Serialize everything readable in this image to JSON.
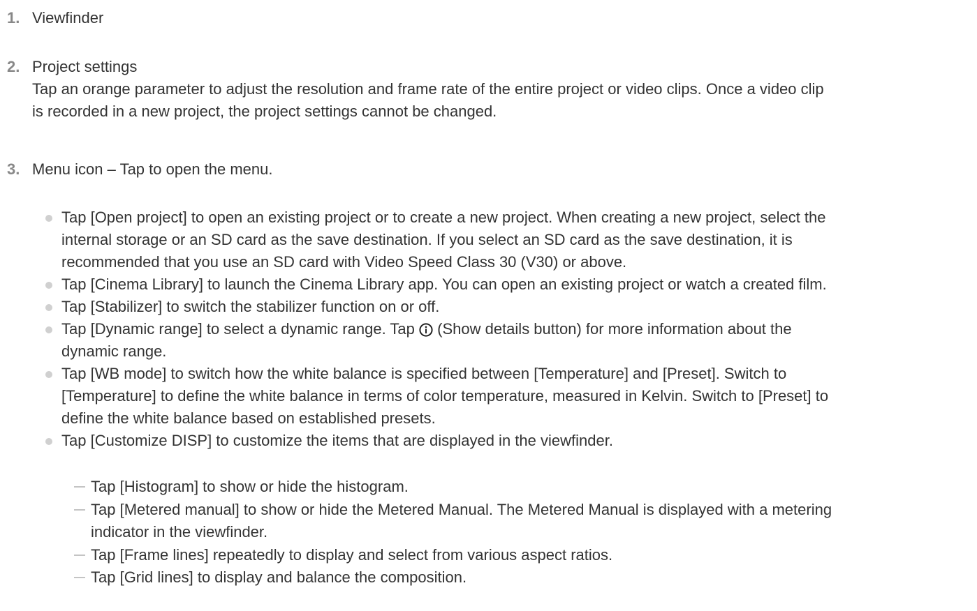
{
  "items": [
    {
      "number": "1.",
      "title": "Viewfinder"
    },
    {
      "number": "2.",
      "title": "Project settings",
      "desc_line1": "Tap an orange parameter to adjust the resolution and frame rate of the entire project or video clips. Once a video clip",
      "desc_line2": "is recorded in a new project, the project settings cannot be changed."
    },
    {
      "number": "3.",
      "title": "Menu icon – Tap to open the menu."
    }
  ],
  "bullets": [
    {
      "lines": [
        "Tap [Open project] to open an existing project or to create a new project. When creating a new project, select the",
        "internal storage or an SD card as the save destination. If you select an SD card as the save destination, it is",
        "recommended that you use an SD card with Video Speed Class 30 (V30) or above."
      ]
    },
    {
      "lines": [
        "Tap [Cinema Library] to launch the Cinema Library app. You can open an existing project or watch a created film."
      ]
    },
    {
      "lines": [
        "Tap [Stabilizer] to switch the stabilizer function on or off."
      ]
    },
    {
      "line1_before_icon": "Tap [Dynamic range] to select a dynamic range. Tap",
      "line1_after_icon": "(Show details button) for more information about the",
      "line2": "dynamic range.",
      "icon": "info-icon"
    },
    {
      "lines": [
        "Tap [WB mode] to switch how the white balance is specified between [Temperature] and [Preset]. Switch to",
        "[Temperature] to define the white balance in terms of color temperature, measured in Kelvin. Switch to [Preset] to",
        "define the white balance based on established presets."
      ]
    },
    {
      "lines": [
        "Tap [Customize DISP] to customize the items that are displayed in the viewfinder."
      ]
    }
  ],
  "sub_items": [
    {
      "lines": [
        "Tap [Histogram] to show or hide the histogram."
      ]
    },
    {
      "lines": [
        "Tap [Metered manual] to show or hide the Metered Manual. The Metered Manual is displayed with a metering",
        "indicator in the viewfinder."
      ]
    },
    {
      "lines": [
        "Tap [Frame lines] repeatedly to display and select from various aspect ratios."
      ]
    },
    {
      "lines": [
        "Tap [Grid lines] to display and balance the composition."
      ]
    }
  ]
}
